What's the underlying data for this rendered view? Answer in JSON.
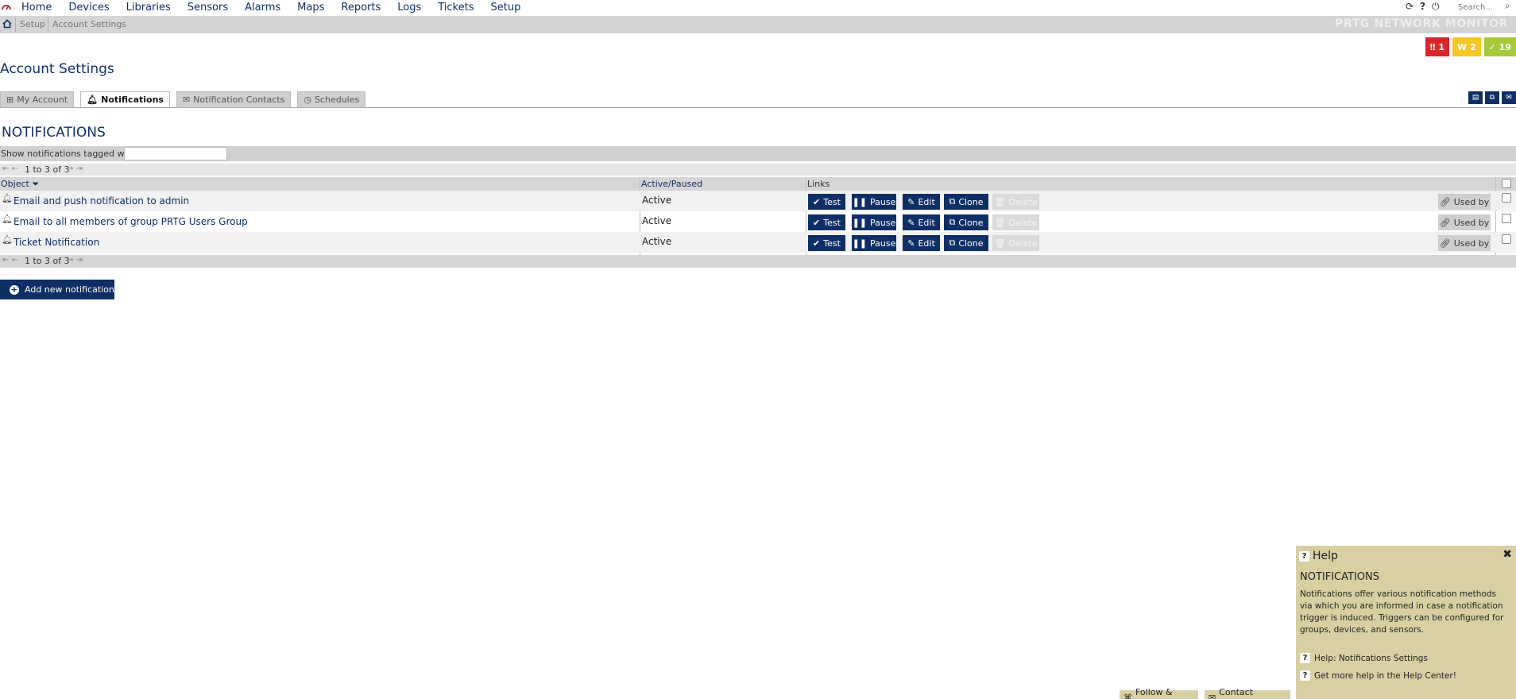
{
  "nav": {
    "items": [
      "Home",
      "Devices",
      "Libraries",
      "Sensors",
      "Alarms",
      "Maps",
      "Reports",
      "Logs",
      "Tickets",
      "Setup"
    ],
    "search_placeholder": "Search...",
    "icons": [
      "refresh-icon",
      "help-icon",
      "logout-icon",
      "search-icon"
    ]
  },
  "breadcrumb": {
    "items": [
      "Setup",
      "Account Settings"
    ]
  },
  "brand": "PRTG NETWORK MONITOR",
  "status_badges": [
    {
      "label": "‼ 1",
      "color": "#d9262c"
    },
    {
      "label": "W 2",
      "color": "#f4c623"
    },
    {
      "label": "✓ 19",
      "color": "#a6c93b"
    }
  ],
  "page_title": "Account Settings",
  "tabs": [
    {
      "label": "My Account",
      "icon": "account-icon",
      "active": false
    },
    {
      "label": "Notifications",
      "icon": "bell-icon",
      "active": true
    },
    {
      "label": "Notification Contacts",
      "icon": "envelope-icon",
      "active": false
    },
    {
      "label": "Schedules",
      "icon": "clock-icon",
      "active": false
    }
  ],
  "section_title": "NOTIFICATIONS",
  "filter": {
    "label": "Show notifications tagged with",
    "value": ""
  },
  "pager": {
    "text": "1 to 3 of 3"
  },
  "table": {
    "columns": [
      "Object ⏷",
      "Active/Paused",
      "Links"
    ],
    "rows": [
      {
        "name": "Email and push notification to admin",
        "status": "Active"
      },
      {
        "name": "Email to all members of group PRTG Users Group",
        "status": "Active"
      },
      {
        "name": "Ticket Notification",
        "status": "Active"
      }
    ],
    "actions": {
      "test": "Test",
      "pause": "Pause",
      "edit": "Edit",
      "clone": "Clone",
      "delete": "Delete",
      "used_by": "Used by"
    }
  },
  "add_button": "Add new notification",
  "help": {
    "title": "Help",
    "heading": "NOTIFICATIONS",
    "body": "Notifications offer various notification methods via which you are informed in case a notification trigger is induced. Triggers can be configured for groups, devices, and sensors.",
    "link1": "Help: Notifications Settings",
    "link2": "Get more help in the Help Center!"
  },
  "footer": {
    "follow": "Follow & Share",
    "contact": "Contact Support"
  },
  "colors": {
    "primary": "#0e2f66",
    "help_bg": "#d8d0a2"
  }
}
